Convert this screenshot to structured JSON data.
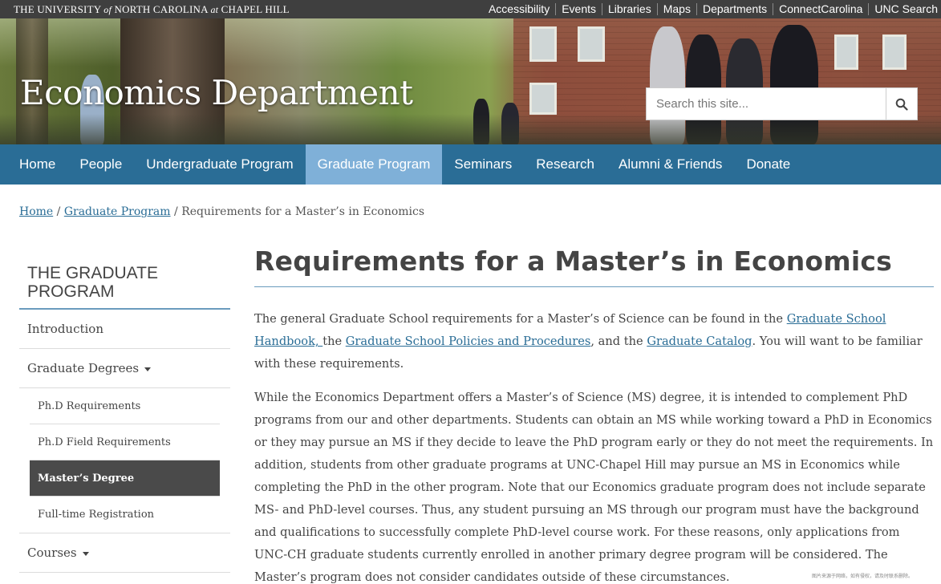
{
  "topbar": {
    "brand_pre": "THE UNIVERSITY",
    "brand_of": "of",
    "brand_mid": "NORTH CAROLINA",
    "brand_at": "at",
    "brand_post": "CHAPEL HILL",
    "links": [
      "Accessibility",
      "Events",
      "Libraries",
      "Maps",
      "Departments",
      "ConnectCarolina",
      "UNC Search"
    ]
  },
  "header": {
    "site_title": "Economics Department",
    "search_placeholder": "Search this site...",
    "search_icon": "search-icon"
  },
  "nav": {
    "items": [
      "Home",
      "People",
      "Undergraduate Program",
      "Graduate Program",
      "Seminars",
      "Research",
      "Alumni & Friends",
      "Donate"
    ],
    "active": "Graduate Program"
  },
  "breadcrumb": {
    "home": "Home",
    "sep1": " / ",
    "section": "Graduate Program",
    "sep2": " / ",
    "current": "Requirements for a Master’s in Economics"
  },
  "sidebar": {
    "title": "THE GRADUATE PROGRAM",
    "intro": "Introduction",
    "degrees": "Graduate Degrees",
    "sub_items": [
      "Ph.D Requirements",
      "Ph.D Field Requirements",
      "Master’s Degree",
      "Full-time Registration"
    ],
    "active_sub": "Master’s Degree",
    "courses": "Courses"
  },
  "main": {
    "title": "Requirements for a Master’s in Economics",
    "p1_a": "The general Graduate School requirements for a Master’s of Science can be found in the ",
    "p1_link1": "Graduate School Handbook, ",
    "p1_b": "the ",
    "p1_link2": "Graduate School Policies and Procedures",
    "p1_c": ", and the ",
    "p1_link3": "Graduate Catalog",
    "p1_d": ". You will want to be familiar with these requirements.",
    "p2": "While the Economics Department offers a Master’s of Science (MS) degree, it is intended to complement PhD programs from our and other departments. Students can obtain an MS while working toward a PhD in Economics or they may pursue an MS if they decide to leave the PhD program early or they do not meet the requirements. In addition, students from other graduate programs at UNC-Chapel Hill may pursue an MS in Economics while completing the PhD in the other program. Note that our Economics graduate program does not include separate MS- and PhD-level courses. Thus, any student pursuing an MS through our program must have the background and qualifications to successfully complete PhD-level course work. For these reasons, only applications from UNC-CH graduate students currently enrolled in another primary degree program will be considered. The Master’s program does not consider candidates outside of these circumstances."
  },
  "watermark": "图片来源于网络，如有侵权，请及时联系删除。",
  "colors": {
    "nav_bg": "#2a6d96",
    "nav_active": "#7fb0d8",
    "topbar_bg": "#3f3f3f",
    "link": "#2a6d96",
    "sidebar_active": "#4a4a4a"
  }
}
